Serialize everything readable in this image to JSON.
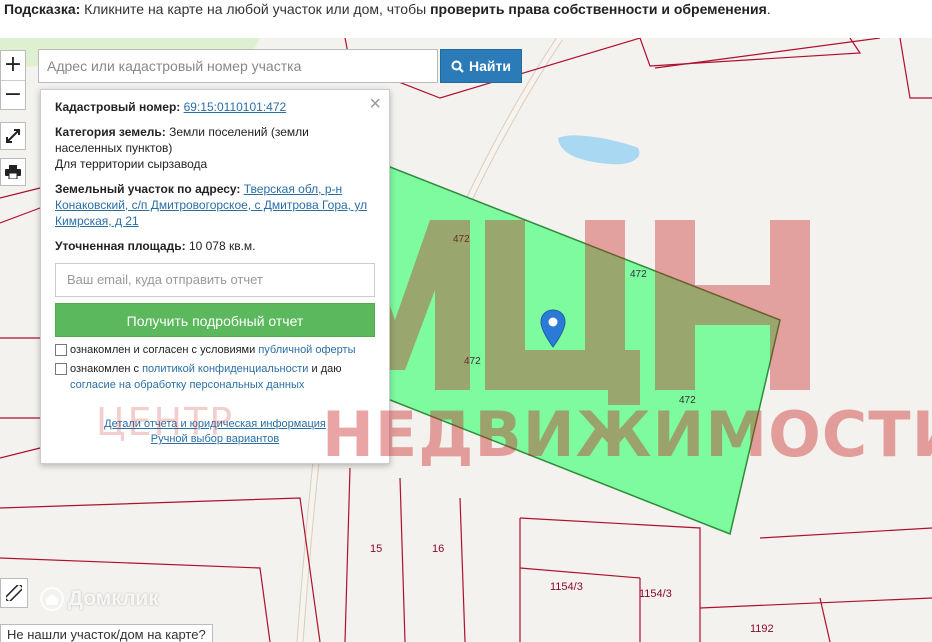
{
  "hint": {
    "label": "Подсказка:",
    "text": " Кликните на карте на любой участок или дом, чтобы ",
    "bold": "проверить права собственности и обременения",
    "end": "."
  },
  "zoom": {
    "in": "+",
    "out": "−"
  },
  "search": {
    "placeholder": "Адрес или кадастровый номер участка",
    "button": "Найти"
  },
  "popup": {
    "close": "×",
    "cadastral_label": "Кадастровый номер:",
    "cadastral_value": "69:15:0110101:472",
    "category_label": "Категория земель:",
    "category_value": "Земли поселений (земли населенных пунктов)",
    "category_note": "Для территории сырзавода",
    "address_label": "Земельный участок по адресу:",
    "address_value": "Тверская обл, р-н Конаковский, с/п Дмитровогорское, с Дмитрова Гора, ул Кимрская, д 21",
    "area_label": "Уточненная площадь:",
    "area_value": "10 078 кв.м.",
    "email_placeholder": "Ваш email, куда отправить отчет",
    "report_button": "Получить подробный отчет",
    "consent1_a": "ознакомлен и согласен с условиями ",
    "consent1_link": "публичной оферты",
    "consent2_a": "ознакомлен с ",
    "consent2_link": "политикой конфиденциальности",
    "consent2_b": " и даю ",
    "consent2_link2": "согласие на обработку персональных данных",
    "details_link": "Детали отчета и юридическая информация",
    "manual_link": "Ручной выбор вариантов"
  },
  "map": {
    "parcel_labels": [
      "472",
      "472",
      "472",
      "472"
    ],
    "lot_labels": [
      "15",
      "16",
      "1154/3",
      "1154/3",
      "1192"
    ],
    "colors": {
      "parcel_fill": "#7dfb9e",
      "parcel_stroke": "#2f8a3a",
      "boundary": "#b0102e",
      "water": "#a9d8f2"
    }
  },
  "watermark": {
    "logo": "МЦН",
    "main": "НЕДВИЖИМОСТИ",
    "small": "ЦЕНТР"
  },
  "brand": {
    "name": "Домклик"
  },
  "not_found": "Не нашли участок/дом на карте?"
}
